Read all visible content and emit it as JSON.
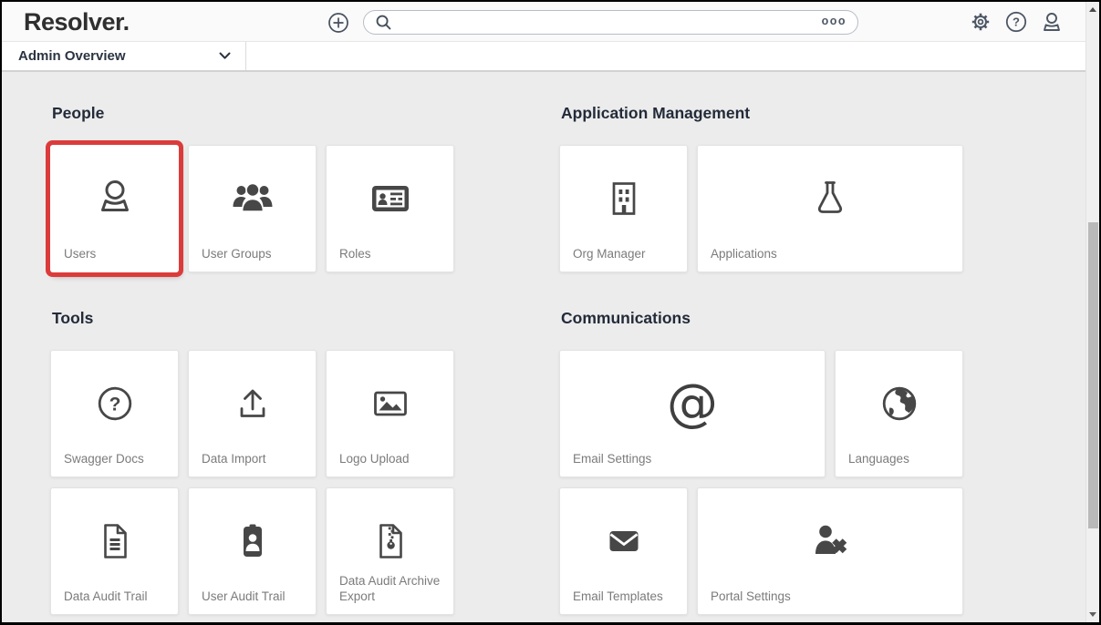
{
  "topbar": {
    "logo": "Resolver.",
    "search_value": "",
    "more_menu": "ooo"
  },
  "navbar": {
    "view_selector": "Admin Overview"
  },
  "glyphs": {
    "question": "?",
    "at": "@"
  },
  "sections": {
    "people": {
      "title": "People",
      "cards": [
        {
          "label": "Users",
          "highlighted": true
        },
        {
          "label": "User Groups"
        },
        {
          "label": "Roles"
        }
      ]
    },
    "application_management": {
      "title": "Application Management",
      "cards": [
        {
          "label": "Org Manager"
        },
        {
          "label": "Applications",
          "wide": true
        }
      ]
    },
    "tools": {
      "title": "Tools",
      "cards": [
        {
          "label": "Swagger Docs"
        },
        {
          "label": "Data Import"
        },
        {
          "label": "Logo Upload"
        },
        {
          "label": "Data Audit Trail"
        },
        {
          "label": "User Audit Trail"
        },
        {
          "label": "Data Audit Archive Export"
        }
      ]
    },
    "communications": {
      "title": "Communications",
      "cards": [
        {
          "label": "Email Settings",
          "wide": true
        },
        {
          "label": "Languages"
        },
        {
          "label": "Email Templates"
        },
        {
          "label": "Portal Settings",
          "wide": true
        }
      ]
    }
  },
  "colors": {
    "highlight_red": "#dc3b3b",
    "icon_dark": "#474747",
    "icon_slate": "#4d5765",
    "header_text": "#232b39",
    "label_text": "#7b7b7b",
    "content_bg": "#ececec"
  }
}
